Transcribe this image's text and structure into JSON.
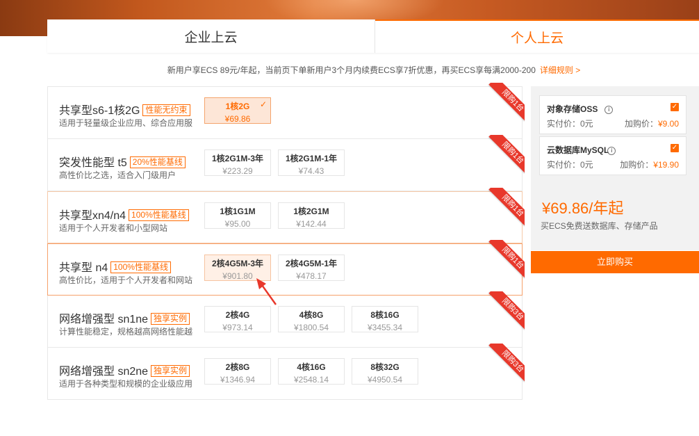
{
  "tabs": [
    {
      "label": "企业上云"
    },
    {
      "label": "个人上云"
    }
  ],
  "notice": {
    "text": "新用户享ECS 89元/年起，当前页下单新用户3个月内续费ECS享7折优惠，再买ECS享每满2000-200",
    "link": "详细规则 >"
  },
  "products": [
    {
      "name": "共享型s6-1核2G",
      "tag": "性能无约束",
      "desc": "适用于轻量级企业应用、综合应用服",
      "ribbon": "限购1台",
      "specs": [
        {
          "name": "1核2G",
          "price": "¥69.86"
        }
      ]
    },
    {
      "name": "突发性能型 t5",
      "tag": "20%性能基线",
      "desc": "高性价比之选，适合入门级用户",
      "ribbon": "限购1台",
      "specs": [
        {
          "name": "1核2G1M-3年",
          "price": "¥223.29"
        },
        {
          "name": "1核2G1M-1年",
          "price": "¥74.43"
        }
      ]
    },
    {
      "name": "共享型xn4/n4",
      "tag": "100%性能基线",
      "desc": "适用于个人开发者和小型网站",
      "ribbon": "限购1台",
      "specs": [
        {
          "name": "1核1G1M",
          "price": "¥95.00"
        },
        {
          "name": "1核2G1M",
          "price": "¥142.44"
        }
      ]
    },
    {
      "name": "共享型 n4",
      "tag": "100%性能基线",
      "desc": "高性价比，适用于个人开发者和网站",
      "ribbon": "限购1台",
      "specs": [
        {
          "name": "2核4G5M-3年",
          "price": "¥901.80"
        },
        {
          "name": "2核4G5M-1年",
          "price": "¥478.17"
        }
      ]
    },
    {
      "name": "网络增强型 sn1ne",
      "tag": "独享实例",
      "desc": "计算性能稳定，规格越高网络性能越",
      "ribbon": "限购3台",
      "specs": [
        {
          "name": "2核4G",
          "price": "¥973.14"
        },
        {
          "name": "4核8G",
          "price": "¥1800.54"
        },
        {
          "name": "8核16G",
          "price": "¥3455.34"
        }
      ]
    },
    {
      "name": "网络增强型 sn2ne",
      "tag": "独享实例",
      "desc": "适用于各种类型和规模的企业级应用",
      "ribbon": "限购3台",
      "specs": [
        {
          "name": "2核8G",
          "price": "¥1346.94"
        },
        {
          "name": "4核16G",
          "price": "¥2548.14"
        },
        {
          "name": "8核32G",
          "price": "¥4950.54"
        }
      ]
    }
  ],
  "summary": {
    "addons": [
      {
        "name": "对象存储OSS",
        "actual_label": "实付价：0元",
        "add_label": "加购价：",
        "add_price": "¥9.00"
      },
      {
        "name": "云数据库MySQL",
        "actual_label": "实付价：0元",
        "add_label": "加购价：",
        "add_price": "¥19.90"
      }
    ],
    "total": "¥69.86/年起",
    "total_desc": "买ECS免费送数据库、存储产品",
    "buy_label": "立即购买"
  },
  "icons": {
    "info": "info-circle-icon",
    "check": "checkmark-icon",
    "arrow": "red-arrow-icon"
  },
  "colors": {
    "accent": "#ff6a00",
    "ribbon": "#e8382b",
    "arrow": "#e8382b"
  }
}
